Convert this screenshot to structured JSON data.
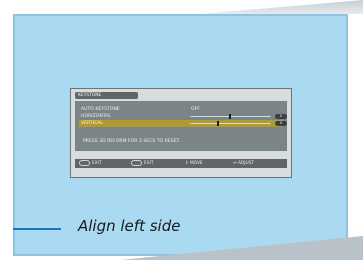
{
  "osd": {
    "title": "KEYSTONE",
    "rows": [
      {
        "label": "AUTO KEYSTONE",
        "value": "OFF"
      },
      {
        "label": "HORIZONTAL",
        "minus": "−",
        "plus": "+",
        "badge": "0",
        "level": 0.5
      },
      {
        "label": "VERTICAL",
        "minus": "−",
        "plus": "+",
        "badge": "0",
        "level": 0.35,
        "selected": true
      }
    ],
    "help_text": "PRESS 3D REFORM FOR 2 SECS TO RESET.",
    "footer": {
      "exit1": "EXIT",
      "exit2": "EXIT",
      "move": "↕ MOVE",
      "adjust": "↔ ADJUST"
    }
  },
  "callout": {
    "text": "Align left side"
  }
}
